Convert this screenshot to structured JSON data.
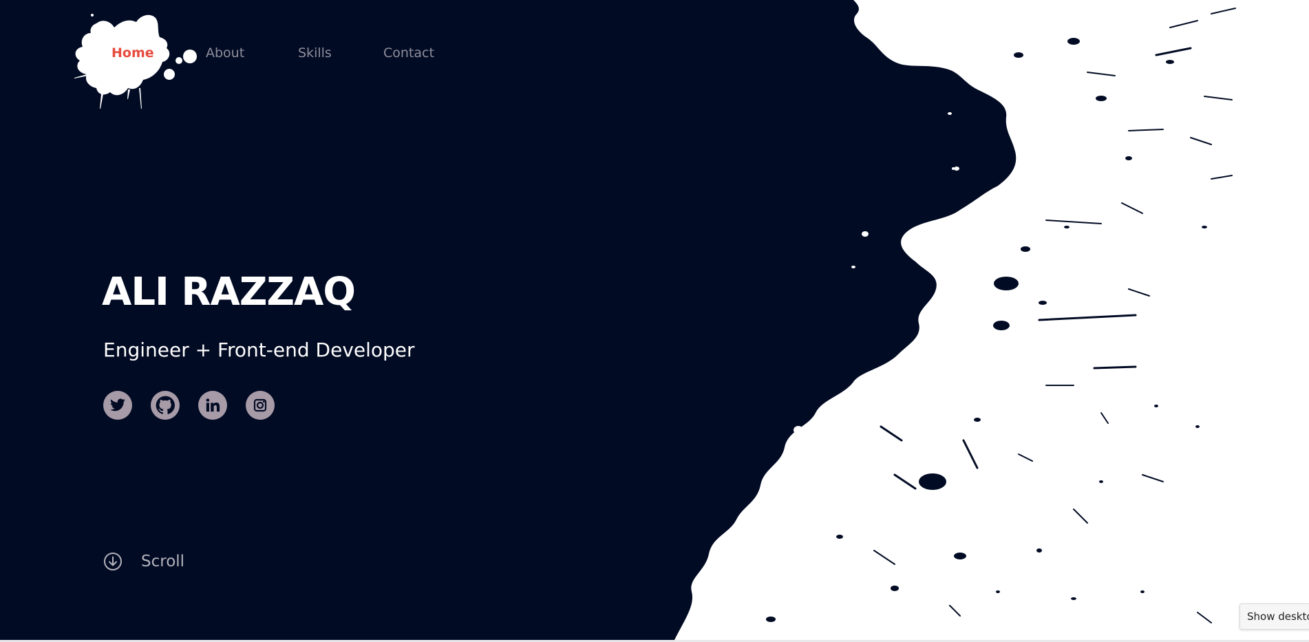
{
  "nav": {
    "items": [
      {
        "label": "Home",
        "active": true
      },
      {
        "label": "About",
        "active": false
      },
      {
        "label": "Skills",
        "active": false
      },
      {
        "label": "Contact",
        "active": false
      }
    ]
  },
  "hero": {
    "title": "ALI RAZZAQ",
    "subtitle": "Engineer + Front-end Developer"
  },
  "social": [
    {
      "name": "twitter",
      "icon": "twitter-icon"
    },
    {
      "name": "github",
      "icon": "github-icon"
    },
    {
      "name": "linkedin",
      "icon": "linkedin-icon"
    },
    {
      "name": "instagram",
      "icon": "instagram-icon"
    }
  ],
  "scroll": {
    "label": "Scroll",
    "icon": "arrow-down-circle-icon"
  },
  "tooltip": {
    "text": "Show desktop"
  },
  "colors": {
    "background": "#020b24",
    "accent": "#e64b3c",
    "nav_text": "#8f8f9c",
    "social_bg": "#a79ba8",
    "splash": "#ffffff"
  }
}
